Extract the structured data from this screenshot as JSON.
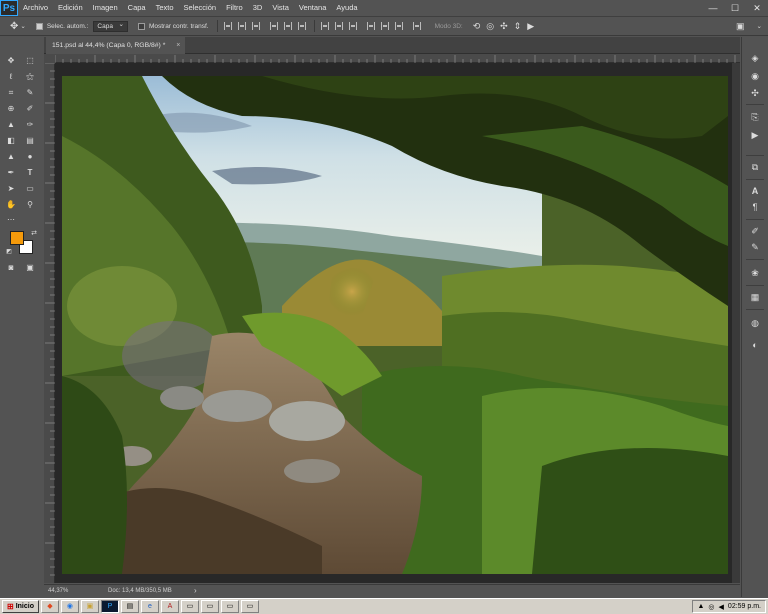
{
  "app": {
    "logo": "Ps"
  },
  "menu": [
    "Archivo",
    "Edición",
    "Imagen",
    "Capa",
    "Texto",
    "Selección",
    "Filtro",
    "3D",
    "Vista",
    "Ventana",
    "Ayuda"
  ],
  "window_controls": {
    "minimize": "—",
    "maximize": "☐",
    "close": "✕"
  },
  "options": {
    "auto_select_label": "Selec. autom.:",
    "auto_select_value": "Capa",
    "transform_label": "Mostrar contr. transf.",
    "mode3d_label": "Modo 3D:"
  },
  "document": {
    "tab_title": "151.psd al 44,4% (Capa 0, RGB/8#) *",
    "close_glyph": "×"
  },
  "status": {
    "zoom": "44,37%",
    "doc_info": "Doc: 13,4 MB/350,5 MB",
    "arrow": "›"
  },
  "color": {
    "foreground": "#f59a0b",
    "background": "#ffffff",
    "accent": "#31a8ff"
  },
  "toolbar_icons": [
    "move-icon",
    "marquee-icon",
    "lasso-icon",
    "magic-wand-icon",
    "crop-icon",
    "eyedropper-icon",
    "healing-icon",
    "brush-icon",
    "stamp-icon",
    "history-brush-icon",
    "eraser-icon",
    "gradient-icon",
    "blur-icon",
    "dodge-icon",
    "pen-icon",
    "type-icon",
    "path-select-icon",
    "shape-icon",
    "hand-icon",
    "zoom-icon"
  ],
  "right_panel_icons": [
    "layers-icon",
    "channels-icon",
    "paths-icon",
    "history-icon",
    "actions-icon",
    "character-icon",
    "paragraph-icon",
    "brushes-icon",
    "swatches-icon",
    "styles-icon",
    "adjustments-icon"
  ],
  "taskbar": {
    "start_label": "Inicio",
    "clock": "02:59 p.m."
  }
}
